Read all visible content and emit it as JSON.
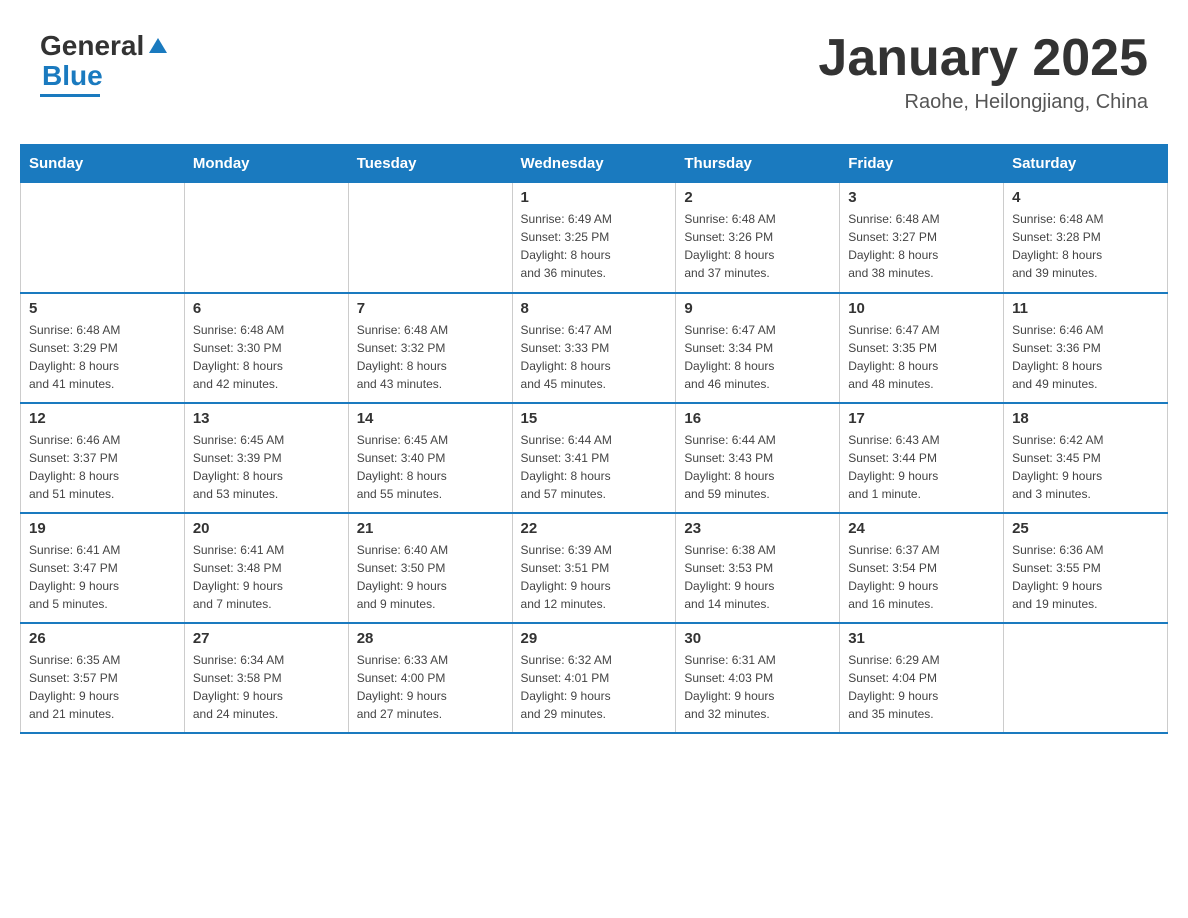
{
  "header": {
    "logo": {
      "text_general": "General",
      "text_blue": "Blue"
    },
    "title": "January 2025",
    "location": "Raohe, Heilongjiang, China"
  },
  "days_of_week": [
    "Sunday",
    "Monday",
    "Tuesday",
    "Wednesday",
    "Thursday",
    "Friday",
    "Saturday"
  ],
  "weeks": [
    [
      {
        "day": "",
        "info": ""
      },
      {
        "day": "",
        "info": ""
      },
      {
        "day": "",
        "info": ""
      },
      {
        "day": "1",
        "info": "Sunrise: 6:49 AM\nSunset: 3:25 PM\nDaylight: 8 hours\nand 36 minutes."
      },
      {
        "day": "2",
        "info": "Sunrise: 6:48 AM\nSunset: 3:26 PM\nDaylight: 8 hours\nand 37 minutes."
      },
      {
        "day": "3",
        "info": "Sunrise: 6:48 AM\nSunset: 3:27 PM\nDaylight: 8 hours\nand 38 minutes."
      },
      {
        "day": "4",
        "info": "Sunrise: 6:48 AM\nSunset: 3:28 PM\nDaylight: 8 hours\nand 39 minutes."
      }
    ],
    [
      {
        "day": "5",
        "info": "Sunrise: 6:48 AM\nSunset: 3:29 PM\nDaylight: 8 hours\nand 41 minutes."
      },
      {
        "day": "6",
        "info": "Sunrise: 6:48 AM\nSunset: 3:30 PM\nDaylight: 8 hours\nand 42 minutes."
      },
      {
        "day": "7",
        "info": "Sunrise: 6:48 AM\nSunset: 3:32 PM\nDaylight: 8 hours\nand 43 minutes."
      },
      {
        "day": "8",
        "info": "Sunrise: 6:47 AM\nSunset: 3:33 PM\nDaylight: 8 hours\nand 45 minutes."
      },
      {
        "day": "9",
        "info": "Sunrise: 6:47 AM\nSunset: 3:34 PM\nDaylight: 8 hours\nand 46 minutes."
      },
      {
        "day": "10",
        "info": "Sunrise: 6:47 AM\nSunset: 3:35 PM\nDaylight: 8 hours\nand 48 minutes."
      },
      {
        "day": "11",
        "info": "Sunrise: 6:46 AM\nSunset: 3:36 PM\nDaylight: 8 hours\nand 49 minutes."
      }
    ],
    [
      {
        "day": "12",
        "info": "Sunrise: 6:46 AM\nSunset: 3:37 PM\nDaylight: 8 hours\nand 51 minutes."
      },
      {
        "day": "13",
        "info": "Sunrise: 6:45 AM\nSunset: 3:39 PM\nDaylight: 8 hours\nand 53 minutes."
      },
      {
        "day": "14",
        "info": "Sunrise: 6:45 AM\nSunset: 3:40 PM\nDaylight: 8 hours\nand 55 minutes."
      },
      {
        "day": "15",
        "info": "Sunrise: 6:44 AM\nSunset: 3:41 PM\nDaylight: 8 hours\nand 57 minutes."
      },
      {
        "day": "16",
        "info": "Sunrise: 6:44 AM\nSunset: 3:43 PM\nDaylight: 8 hours\nand 59 minutes."
      },
      {
        "day": "17",
        "info": "Sunrise: 6:43 AM\nSunset: 3:44 PM\nDaylight: 9 hours\nand 1 minute."
      },
      {
        "day": "18",
        "info": "Sunrise: 6:42 AM\nSunset: 3:45 PM\nDaylight: 9 hours\nand 3 minutes."
      }
    ],
    [
      {
        "day": "19",
        "info": "Sunrise: 6:41 AM\nSunset: 3:47 PM\nDaylight: 9 hours\nand 5 minutes."
      },
      {
        "day": "20",
        "info": "Sunrise: 6:41 AM\nSunset: 3:48 PM\nDaylight: 9 hours\nand 7 minutes."
      },
      {
        "day": "21",
        "info": "Sunrise: 6:40 AM\nSunset: 3:50 PM\nDaylight: 9 hours\nand 9 minutes."
      },
      {
        "day": "22",
        "info": "Sunrise: 6:39 AM\nSunset: 3:51 PM\nDaylight: 9 hours\nand 12 minutes."
      },
      {
        "day": "23",
        "info": "Sunrise: 6:38 AM\nSunset: 3:53 PM\nDaylight: 9 hours\nand 14 minutes."
      },
      {
        "day": "24",
        "info": "Sunrise: 6:37 AM\nSunset: 3:54 PM\nDaylight: 9 hours\nand 16 minutes."
      },
      {
        "day": "25",
        "info": "Sunrise: 6:36 AM\nSunset: 3:55 PM\nDaylight: 9 hours\nand 19 minutes."
      }
    ],
    [
      {
        "day": "26",
        "info": "Sunrise: 6:35 AM\nSunset: 3:57 PM\nDaylight: 9 hours\nand 21 minutes."
      },
      {
        "day": "27",
        "info": "Sunrise: 6:34 AM\nSunset: 3:58 PM\nDaylight: 9 hours\nand 24 minutes."
      },
      {
        "day": "28",
        "info": "Sunrise: 6:33 AM\nSunset: 4:00 PM\nDaylight: 9 hours\nand 27 minutes."
      },
      {
        "day": "29",
        "info": "Sunrise: 6:32 AM\nSunset: 4:01 PM\nDaylight: 9 hours\nand 29 minutes."
      },
      {
        "day": "30",
        "info": "Sunrise: 6:31 AM\nSunset: 4:03 PM\nDaylight: 9 hours\nand 32 minutes."
      },
      {
        "day": "31",
        "info": "Sunrise: 6:29 AM\nSunset: 4:04 PM\nDaylight: 9 hours\nand 35 minutes."
      },
      {
        "day": "",
        "info": ""
      }
    ]
  ]
}
